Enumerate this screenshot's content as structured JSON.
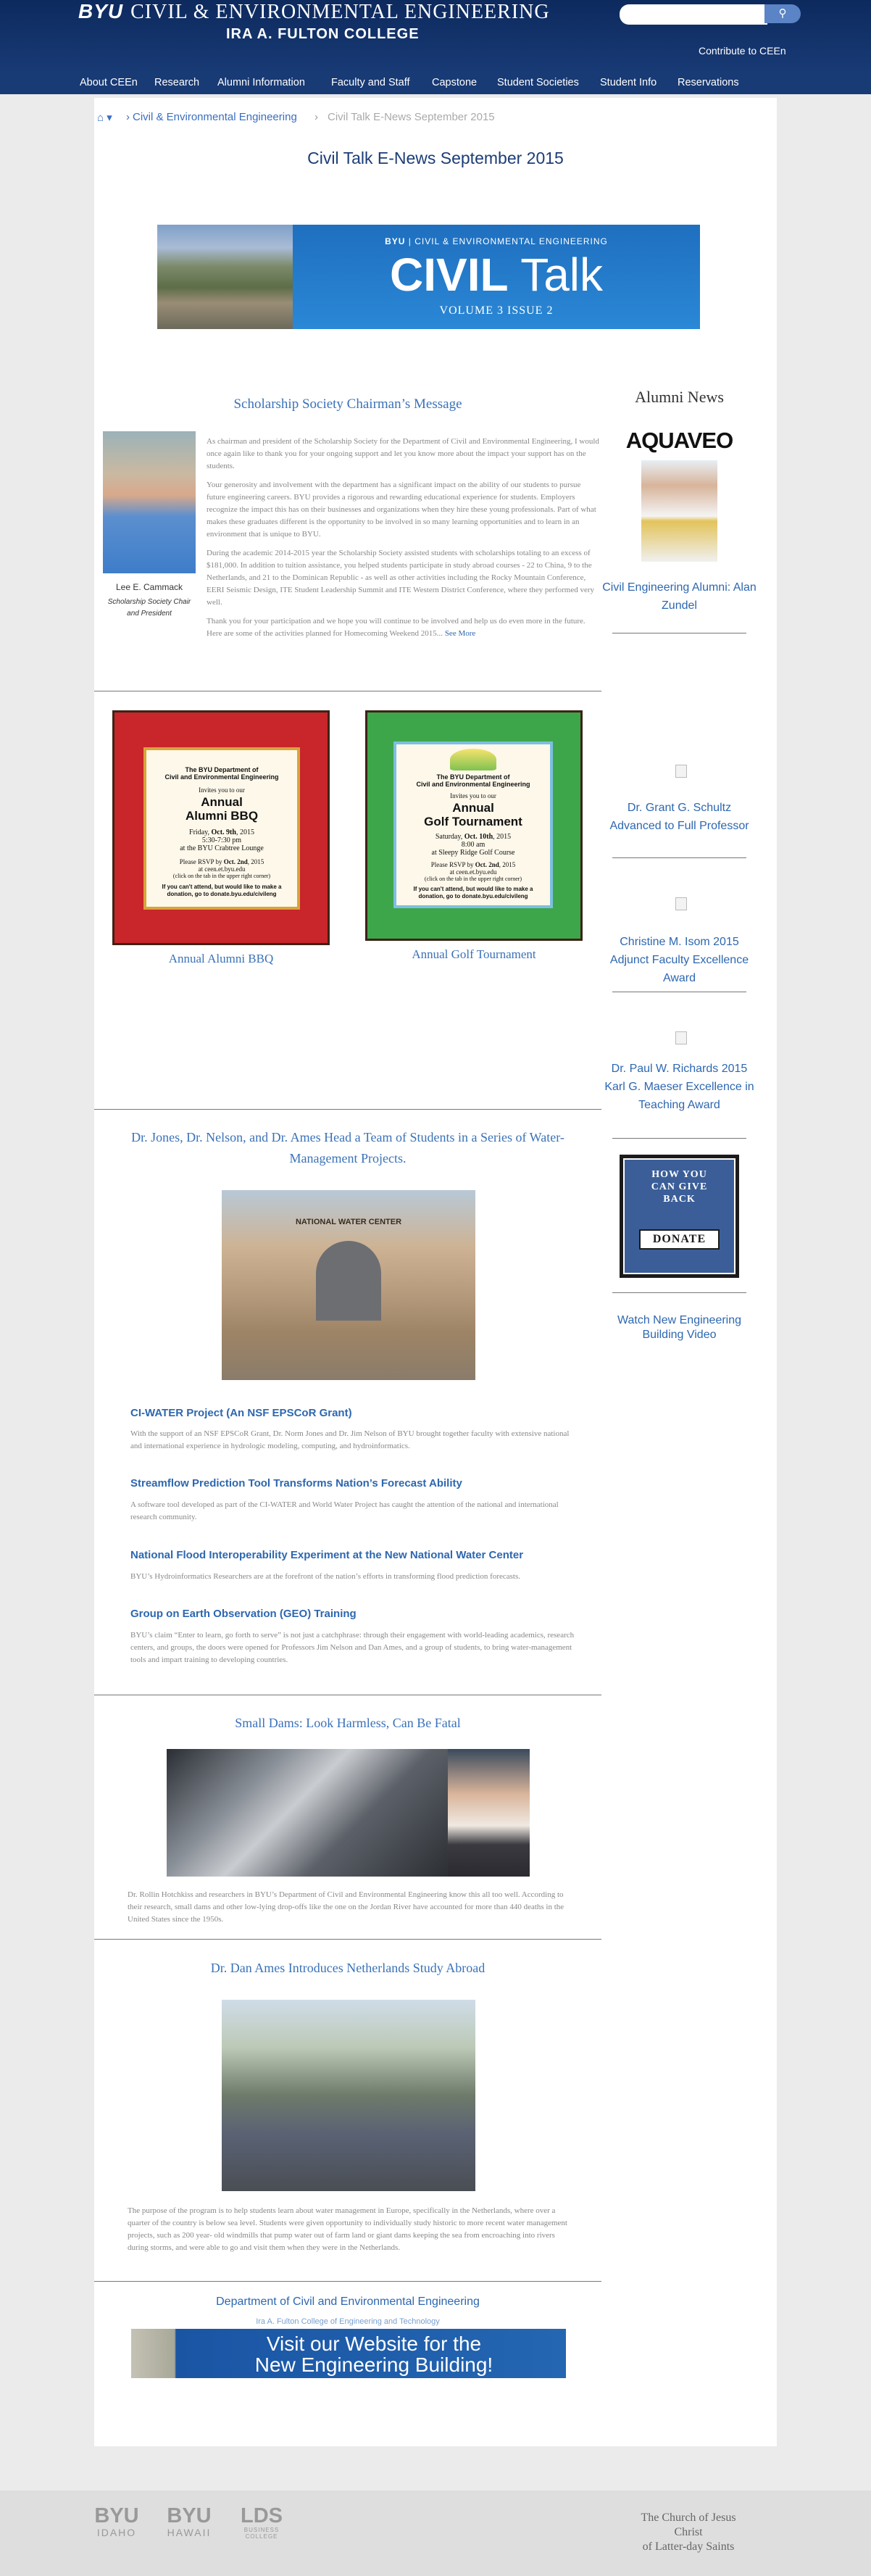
{
  "header": {
    "brand_mark": "BYU",
    "brand_text": "CIVIL & ENVIRONMENTAL ENGINEERING",
    "college": "IRA A. FULTON COLLEGE",
    "search_placeholder": "",
    "search_icon": "search-icon",
    "contribute": "Contribute to CEEn"
  },
  "nav": {
    "items": [
      "About CEEn",
      "Research",
      "Alumni Information",
      "Faculty and Staff",
      "Capstone",
      "Student Societies",
      "Student Info",
      "Reservations"
    ]
  },
  "breadcrumb": {
    "home_icon": "home-icon",
    "sep": "›",
    "parent": "Civil & Environmental Engineering",
    "current": "Civil Talk E-News September 2015"
  },
  "page_title": "Civil Talk E-News September 2015",
  "banner": {
    "mark": "BYU",
    "line": "CIVIL & ENVIRONMENTAL ENGINEERING",
    "civil": "CIVIL",
    "talk": "Talk",
    "volume": "VOLUME 3 ISSUE 2"
  },
  "chairman": {
    "title": "Scholarship Society Chairman’s Message",
    "name": "Lee E. Cammack",
    "role": "Scholarship Society Chair and President",
    "paragraphs": [
      "As chairman and president of the Scholarship Society for the Department of Civil and Environmental Engineering, I would once again like to thank you for your ongoing support and let you know more about the impact your support has on the students.",
      "Your generosity and involvement with the department has a significant impact on the ability of our students to pursue future engineering careers. BYU provides a rigorous and rewarding educational experience for students. Employers recognize the impact this has on their businesses and organizations when they hire these young professionals. Part of what makes these graduates different is the opportunity to be involved in so many learning opportunities and to learn in an environment that is unique to BYU.",
      "During the academic 2014-2015 year the Scholarship Society assisted students with scholarships totaling to an excess of $181,000. In addition to tuition assistance, you helped students participate in study abroad courses - 22 to China, 9 to the Netherlands, and 21 to the Dominican Republic - as well as other activities including the Rocky Mountain Conference, EERI Seismic Design, ITE Student Leadership Summit and ITE Western District Conference, where they performed very well.",
      "Thank you for your participation and we hope you will continue to be involved and help us do even more in the future. Here are some of the activities planned for Homecoming Weekend 2015..."
    ],
    "see_more": "See More"
  },
  "bbq": {
    "dept1": "The BYU Department of",
    "dept2": "Civil and Environmental Engineering",
    "invites": "Invites you to our",
    "event1": "Annual",
    "event2": "Alumni BBQ",
    "date_pre": "Friday, ",
    "date_b": "Oct. 9th",
    "date_post": ", 2015",
    "time": "5:30-7:30 pm",
    "place": "at the BYU Crabtree Lounge",
    "rsvp_pre": "Please RSVP by ",
    "rsvp_b": "Oct. 2nd",
    "rsvp_post": ", 2015",
    "site": "at ceen.et.byu.edu",
    "click": "(click on the tab in the upper right corner)",
    "donate": "If you can't attend, but would like to make a donation, go to donate.byu.edu/civileng",
    "caption": "Annual Alumni BBQ"
  },
  "golf": {
    "dept1": "The BYU Department of",
    "dept2": "Civil and Environmental Engineering",
    "invites": "Invites you to our",
    "event1": "Annual",
    "event2": "Golf Tournament",
    "date_pre": "Saturday, ",
    "date_b": "Oct. 10th",
    "date_post": ", 2015",
    "time": "8:00 am",
    "place": "at Sleepy Ridge Golf Course",
    "rsvp_pre": "Please RSVP by ",
    "rsvp_b": "Oct. 2nd",
    "rsvp_post": ", 2015",
    "site": "at ceen.et.byu.edu",
    "click": "(click on the tab in the upper right corner)",
    "donate": "If you can't attend, but would like to make a donation, go to donate.byu.edu/civileng",
    "caption": "Annual Golf Tournament"
  },
  "water": {
    "title": "Dr. Jones, Dr. Nelson, and Dr. Ames Head a Team of Students in a Series of Water-Management Projects.",
    "building_sign": "NATIONAL WATER CENTER",
    "items": [
      {
        "h": "CI-WATER Project (An NSF EPSCoR Grant)",
        "t": "With the support of an NSF EPSCoR Grant, Dr. Norm Jones and Dr. Jim Nelson of BYU brought together faculty with extensive national and international experience in hydrologic modeling, computing, and hydroinformatics."
      },
      {
        "h": "Streamflow Prediction Tool Transforms Nation’s Forecast Ability",
        "t": "A software tool developed as part of the CI-WATER and World Water Project has caught the attention of the national and international research community."
      },
      {
        "h": "National Flood Interoperability Experiment at the New National Water Center",
        "t": "BYU’s Hydroinformatics Researchers are at the forefront of the nation’s efforts in transforming flood prediction forecasts."
      },
      {
        "h": "Group on Earth Observation (GEO) Training",
        "t": "BYU’s claim “Enter to learn, go forth to serve” is not just a catchphrase: through their engagement with world-leading academics, research centers, and groups, the doors were opened for Professors Jim Nelson and Dan Ames, and a group of students, to bring water-management tools and impart training to developing countries."
      }
    ]
  },
  "dams": {
    "title": "Small Dams: Look Harmless, Can Be Fatal",
    "text": "Dr. Rollin Hotchkiss and researchers in BYU’s Department of Civil and Environmental Engineering know this all too well. According to their research, small dams and other low-lying drop-offs like the one on the Jordan River have accounted for more than 440 deaths in the United States since the 1950s."
  },
  "netherlands": {
    "title": "Dr. Dan Ames Introduces Netherlands Study Abroad",
    "text": "The purpose of the program is to help students learn about water management in Europe, specifically in the Netherlands, where over a quarter of the country is below sea level. Students were given opportunity to individually study historic to more recent water management projects, such as 200 year- old windmills that pump water out of farm land or giant dams keeping the sea from encroaching into rivers during storms, and were able to go and visit them when they were in the Netherlands."
  },
  "footer_block": {
    "dept": "Department of Civil and Environmental Engineering",
    "college": "Ira A. Fulton College of Engineering and Technology",
    "visit1": "Visit our Website for the",
    "visit2": "New Engineering Building!"
  },
  "sidebar": {
    "title": "Alumni News",
    "aquaveo": "AQUAVEO",
    "items": [
      "Civil Engineering Alumni: Alan Zundel",
      "Dr. Grant G. Schultz Advanced to Full Professor",
      "Christine M. Isom 2015 Adjunct Faculty Excellence Award",
      "Dr. Paul W. Richards 2015 Karl G. Maeser Excellence in Teaching Award"
    ],
    "give1": "HOW YOU",
    "give2": "CAN GIVE",
    "give3": "BACK",
    "donate": "DONATE",
    "video": "Watch New Engineering Building Video"
  },
  "footer": {
    "logos": [
      {
        "big": "BYU",
        "small": "IDAHO"
      },
      {
        "big": "BYU",
        "small": "HAWAII"
      },
      {
        "big": "LDS",
        "small": "BUSINESS COLLEGE"
      }
    ],
    "church1": "The Church of Jesus Christ",
    "church2": "of Latter-day Saints"
  },
  "colors": {
    "header": "#183a75",
    "link": "#2d67b0",
    "bbq_frame": "#c8262a",
    "golf_frame": "#3da64a"
  }
}
